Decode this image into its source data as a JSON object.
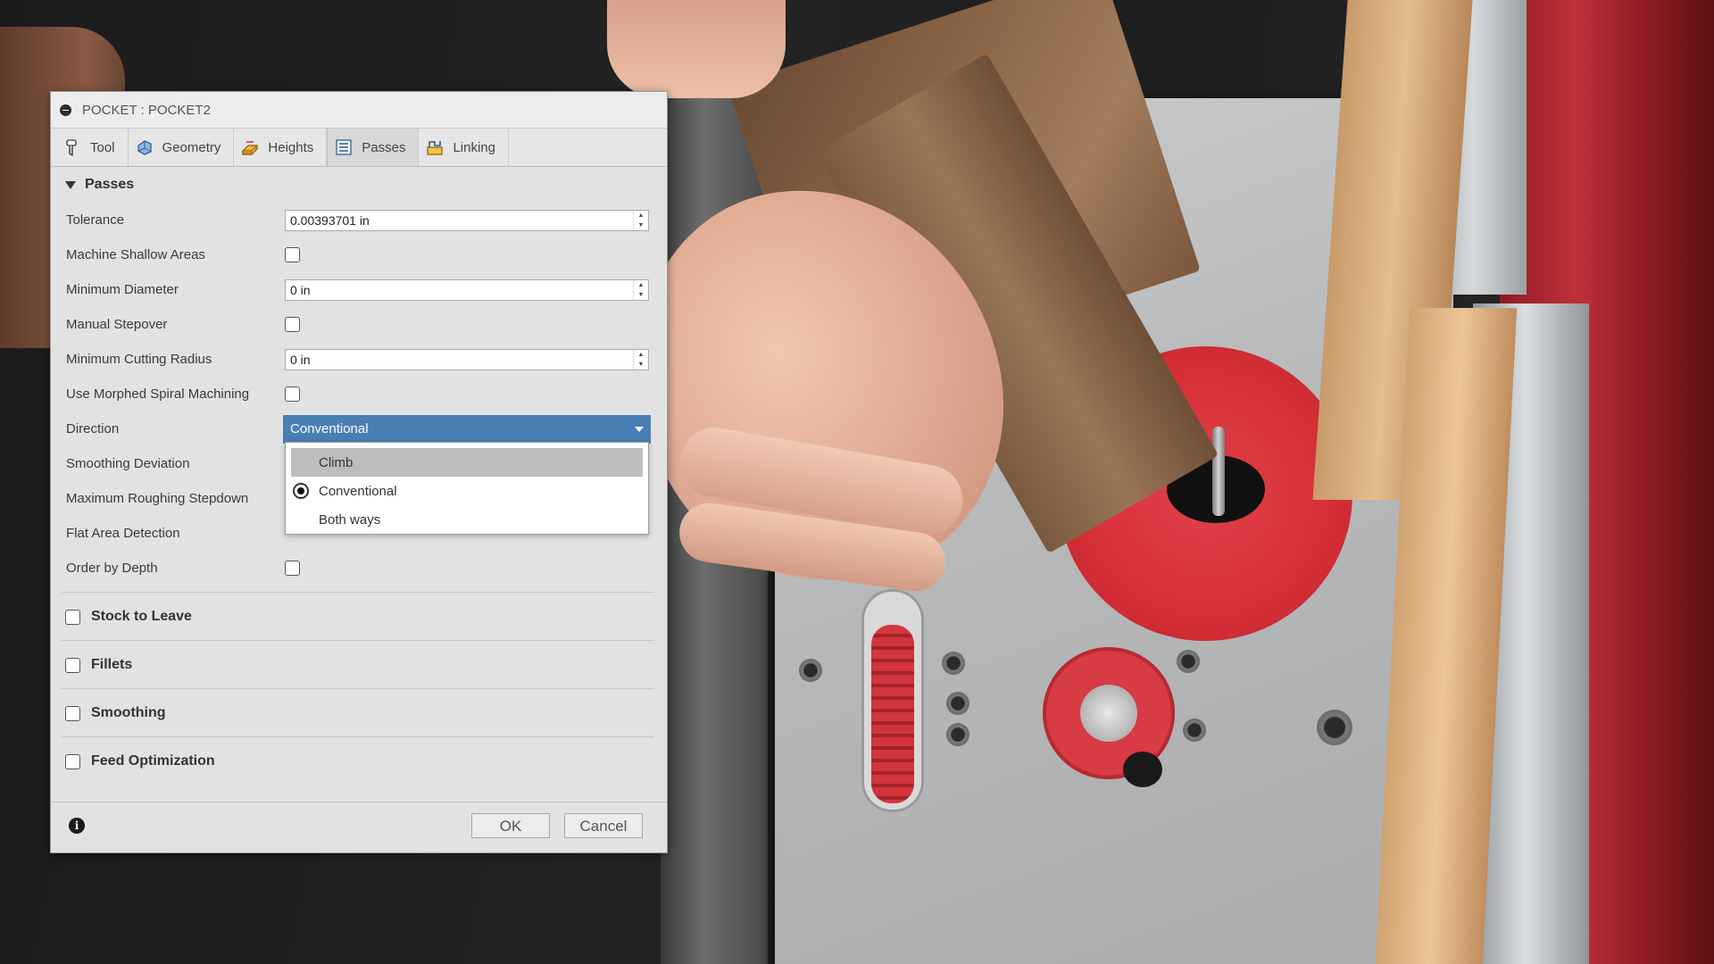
{
  "dialog": {
    "title": "POCKET : POCKET2",
    "tabs": [
      {
        "label": "Tool",
        "icon": "tool-icon"
      },
      {
        "label": "Geometry",
        "icon": "geometry-icon"
      },
      {
        "label": "Heights",
        "icon": "heights-icon"
      },
      {
        "label": "Passes",
        "icon": "passes-icon",
        "active": true
      },
      {
        "label": "Linking",
        "icon": "linking-icon"
      }
    ],
    "section": "Passes",
    "fields": {
      "tolerance_label": "Tolerance",
      "tolerance_value": "0.00393701 in",
      "machine_shallow_label": "Machine Shallow Areas",
      "min_diameter_label": "Minimum Diameter",
      "min_diameter_value": "0 in",
      "manual_stepover_label": "Manual Stepover",
      "min_cutting_radius_label": "Minimum Cutting Radius",
      "min_cutting_radius_value": "0 in",
      "morphed_spiral_label": "Use Morphed Spiral Machining",
      "direction_label": "Direction",
      "direction_value": "Conventional",
      "smoothing_deviation_label": "Smoothing Deviation",
      "max_roughing_label": "Maximum Roughing Stepdown",
      "flat_area_label": "Flat Area Detection",
      "order_by_depth_label": "Order by Depth"
    },
    "direction_options": [
      "Climb",
      "Conventional",
      "Both ways"
    ],
    "direction_selected": "Conventional",
    "groups": [
      "Stock to Leave",
      "Fillets",
      "Smoothing",
      "Feed Optimization"
    ],
    "buttons": {
      "ok": "OK",
      "cancel": "Cancel"
    }
  },
  "colors": {
    "select_accent": "#4a7fb5",
    "router_red": "#d62f37"
  }
}
